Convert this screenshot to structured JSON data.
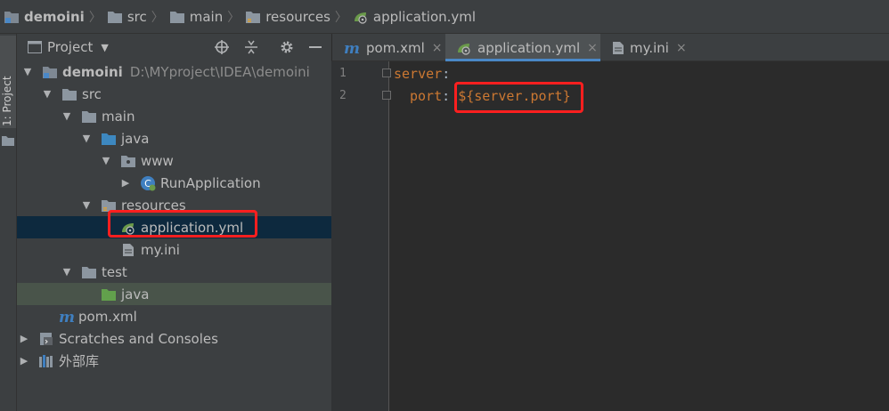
{
  "breadcrumb": {
    "items": [
      {
        "label": "demoini",
        "icon": "module-folder-icon",
        "bold": true
      },
      {
        "label": "src",
        "icon": "folder-icon"
      },
      {
        "label": "main",
        "icon": "folder-icon"
      },
      {
        "label": "resources",
        "icon": "resources-folder-icon"
      },
      {
        "label": "application.yml",
        "icon": "spring-yml-icon"
      }
    ]
  },
  "side_strip": {
    "tab_label": "1: Project"
  },
  "project_panel": {
    "title": "Project",
    "tree": [
      {
        "label": "demoini",
        "path": "D:\\MYproject\\IDEA\\demoini",
        "icon": "module-folder-icon",
        "expanded": true
      },
      {
        "label": "src",
        "icon": "folder-icon",
        "expanded": true
      },
      {
        "label": "main",
        "icon": "folder-icon",
        "expanded": true
      },
      {
        "label": "java",
        "icon": "source-folder-icon",
        "expanded": true
      },
      {
        "label": "www",
        "icon": "package-icon",
        "expanded": true
      },
      {
        "label": "RunApplication",
        "icon": "spring-boot-class-icon",
        "expanded": false
      },
      {
        "label": "resources",
        "icon": "resources-folder-icon",
        "expanded": true
      },
      {
        "label": "application.yml",
        "icon": "spring-yml-icon",
        "selected": true
      },
      {
        "label": "my.ini",
        "icon": "text-file-icon"
      },
      {
        "label": "test",
        "icon": "folder-icon",
        "expanded": true
      },
      {
        "label": "java",
        "icon": "test-source-folder-icon"
      },
      {
        "label": "pom.xml",
        "icon": "maven-icon"
      },
      {
        "label": "Scratches and Consoles",
        "icon": "scratches-icon",
        "expanded": false
      },
      {
        "label": "外部库",
        "icon": "libraries-icon",
        "expanded": false
      }
    ]
  },
  "editor": {
    "tabs": [
      {
        "label": "pom.xml",
        "icon": "maven-icon",
        "active": false
      },
      {
        "label": "application.yml",
        "icon": "spring-yml-icon",
        "active": true
      },
      {
        "label": "my.ini",
        "icon": "text-file-icon",
        "active": false
      }
    ],
    "close_glyph": "×",
    "line_numbers": [
      "1",
      "2"
    ],
    "lines": [
      {
        "key": "server",
        "colon": ":",
        "value": ""
      },
      {
        "key": "port",
        "colon": ":",
        "value": "${server.port}"
      }
    ]
  },
  "colors": {
    "highlight_box": "#ff1f1f",
    "selection": "#0d293e",
    "yaml_key": "#cc7832",
    "active_tab_underline": "#4a88c7"
  }
}
